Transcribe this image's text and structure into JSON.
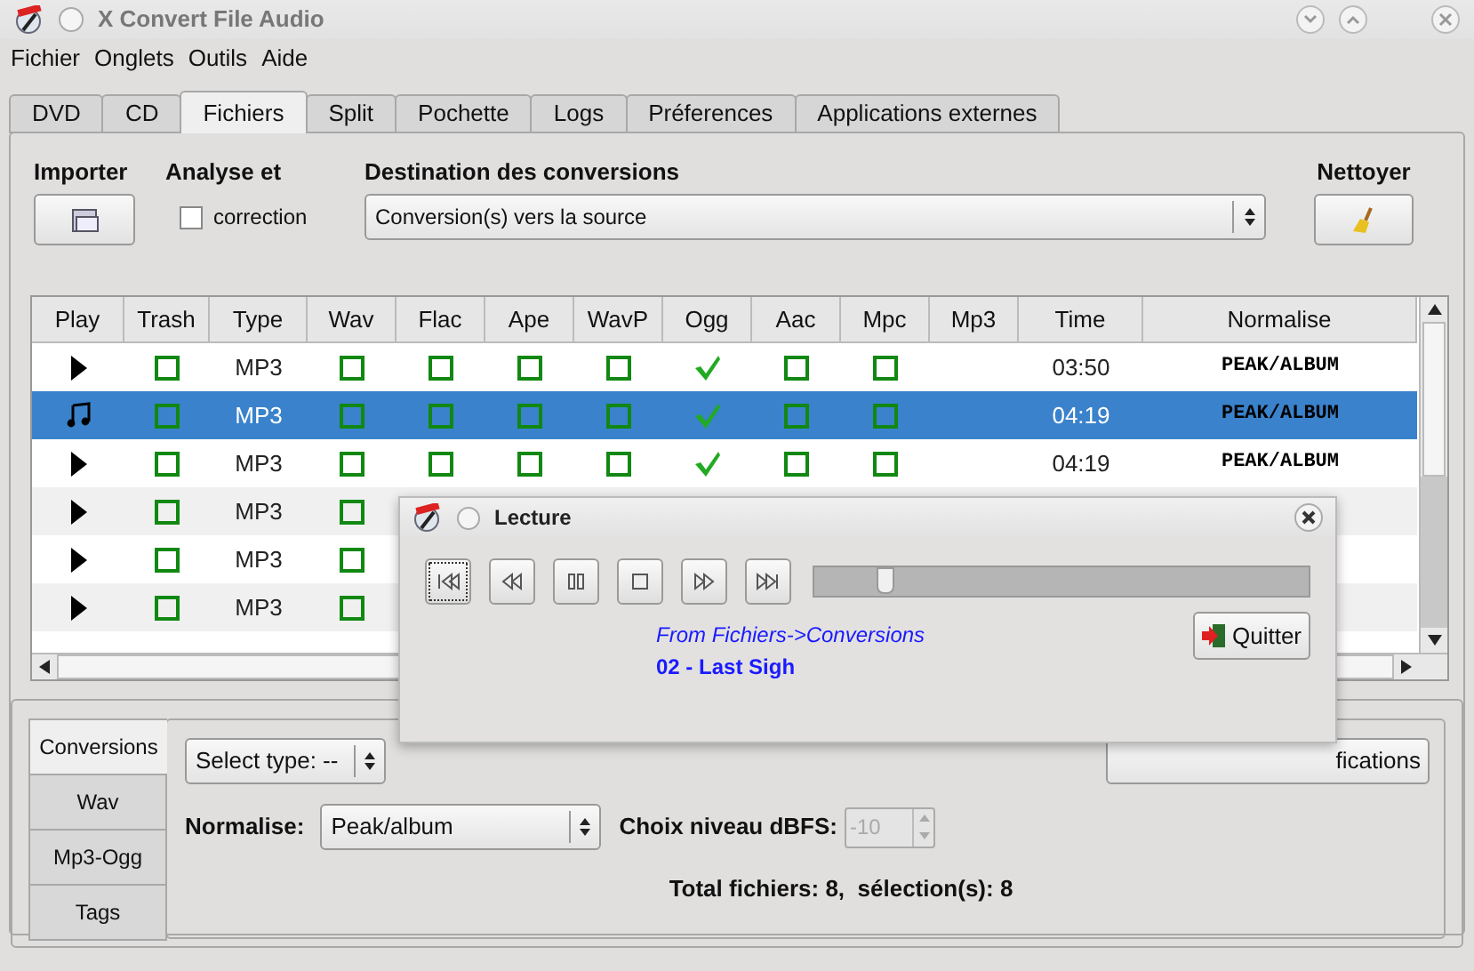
{
  "window": {
    "title": "X Convert File Audio"
  },
  "menu": [
    "Fichier",
    "Onglets",
    "Outils",
    "Aide"
  ],
  "tabs": [
    {
      "label": "DVD",
      "selected": false
    },
    {
      "label": "CD",
      "selected": false
    },
    {
      "label": "Fichiers",
      "selected": true
    },
    {
      "label": "Split",
      "selected": false
    },
    {
      "label": "Pochette",
      "selected": false
    },
    {
      "label": "Logs",
      "selected": false
    },
    {
      "label": "Préferences",
      "selected": false
    },
    {
      "label": "Applications externes",
      "selected": false
    }
  ],
  "import": {
    "label": "Importer"
  },
  "analyse": {
    "label": "Analyse et",
    "checkbox_label": "correction",
    "checked": false
  },
  "destination": {
    "label": "Destination des conversions",
    "value": "Conversion(s) vers la source"
  },
  "clean": {
    "label": "Nettoyer"
  },
  "table": {
    "columns": [
      "Play",
      "Trash",
      "Type",
      "Wav",
      "Flac",
      "Ape",
      "WavP",
      "Ogg",
      "Aac",
      "Mpc",
      "Mp3",
      "Time",
      "Normalise"
    ],
    "rows": [
      {
        "kind": "arrow",
        "selected": false,
        "trash": false,
        "type": "MP3",
        "checks": [
          false,
          false,
          false,
          false,
          true,
          false,
          false
        ],
        "time": "03:50",
        "normalise": "PEAK/ALBUM"
      },
      {
        "kind": "note",
        "selected": true,
        "trash": false,
        "type": "MP3",
        "checks": [
          false,
          false,
          false,
          false,
          true,
          false,
          false
        ],
        "time": "04:19",
        "normalise": "PEAK/ALBUM"
      },
      {
        "kind": "arrow",
        "selected": false,
        "trash": false,
        "type": "MP3",
        "checks": [
          false,
          false,
          false,
          false,
          true,
          false,
          false
        ],
        "time": "04:19",
        "normalise": "PEAK/ALBUM"
      },
      {
        "kind": "arrow",
        "selected": false,
        "trash": false,
        "type": "MP3",
        "checks": [
          false
        ]
      },
      {
        "kind": "arrow",
        "selected": false,
        "trash": false,
        "type": "MP3",
        "checks": [
          false
        ]
      },
      {
        "kind": "arrow",
        "selected": false,
        "trash": false,
        "type": "MP3",
        "checks": [
          false
        ]
      }
    ]
  },
  "side_tabs": [
    {
      "label": "Conversions",
      "selected": true
    },
    {
      "label": "Wav",
      "selected": false
    },
    {
      "label": "Mp3-Ogg",
      "selected": false
    },
    {
      "label": "Tags",
      "selected": false
    }
  ],
  "select_type": {
    "value": "Select type: --"
  },
  "verify_button": {
    "label": "fications"
  },
  "normalise": {
    "label": "Normalise:",
    "value": "Peak/album"
  },
  "dbfs": {
    "label": "Choix niveau dBFS:",
    "value": "-10",
    "disabled": true
  },
  "totals": "Total fichiers: 8,  sélection(s): 8",
  "player": {
    "title": "Lecture",
    "position": {
      "level": 0.13
    },
    "source": "From Fichiers->Conversions",
    "track": "02 - Last Sigh",
    "quit": "Quitter"
  }
}
